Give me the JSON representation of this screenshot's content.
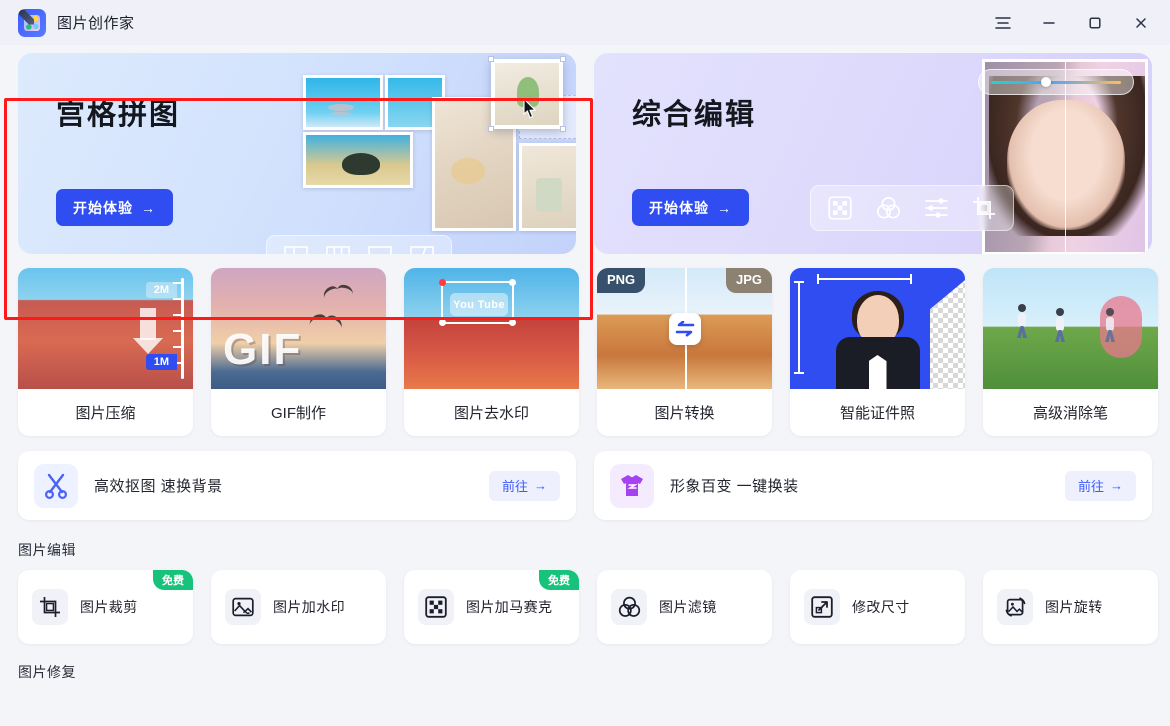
{
  "window": {
    "title": "图片创作家",
    "app_icon": "app-logo-icon",
    "controls": [
      {
        "name": "menu-button",
        "icon": "hamburger-menu-icon"
      },
      {
        "name": "minimize-button",
        "icon": "minimize-icon"
      },
      {
        "name": "maximize-button",
        "icon": "maximize-icon"
      },
      {
        "name": "close-button",
        "icon": "close-icon"
      }
    ]
  },
  "hero": [
    {
      "title": "宫格拼图",
      "cta": "开始体验",
      "cta_arrow": "→",
      "highlighted": true,
      "toolbar_icons": [
        "grid-2-layout-icon",
        "grid-3-columns-icon",
        "grid-rows-layout-icon",
        "grid-diagonal-icon"
      ]
    },
    {
      "title": "综合编辑",
      "cta": "开始体验",
      "cta_arrow": "→",
      "highlighted": false,
      "toolbar_icons": [
        "mosaic-icon",
        "filter-circles-icon",
        "adjust-sliders-icon",
        "crop-icon"
      ]
    }
  ],
  "features": [
    {
      "label": "图片压缩",
      "thumb": "compress-thumb",
      "tags": [
        "2M",
        "1M"
      ]
    },
    {
      "label": "GIF制作",
      "thumb": "gif-thumb",
      "word": "GIF"
    },
    {
      "label": "图片去水印",
      "thumb": "watermark-thumb",
      "word": "You Tube"
    },
    {
      "label": "图片转换",
      "thumb": "convert-thumb",
      "tags": [
        "PNG",
        "JPG"
      ]
    },
    {
      "label": "智能证件照",
      "thumb": "id-photo-thumb"
    },
    {
      "label": "高级消除笔",
      "thumb": "eraser-thumb"
    }
  ],
  "banners": [
    {
      "text": "高效抠图 速换背景",
      "icon": "scissors-icon",
      "action": "前往",
      "arrow": "→"
    },
    {
      "text": "形象百变 一键换装",
      "icon": "tshirt-icon",
      "action": "前往",
      "arrow": "→"
    }
  ],
  "sections": [
    {
      "title": "图片编辑",
      "tiles": [
        {
          "label": "图片裁剪",
          "icon": "crop-icon",
          "badge": "免费"
        },
        {
          "label": "图片加水印",
          "icon": "watermark-image-icon",
          "badge": ""
        },
        {
          "label": "图片加马赛克",
          "icon": "mosaic-icon",
          "badge": "免费"
        },
        {
          "label": "图片滤镜",
          "icon": "filter-circles-icon",
          "badge": ""
        },
        {
          "label": "修改尺寸",
          "icon": "resize-icon",
          "badge": ""
        },
        {
          "label": "图片旋转",
          "icon": "rotate-image-icon",
          "badge": ""
        }
      ]
    }
  ],
  "bottom_section_title": "图片修复",
  "colors": {
    "accent": "#2f4df0",
    "accent_soft": "#eef0fe",
    "badge_green": "#17c37b",
    "annotation_red": "#ff1a1a",
    "page_bg": "#f4f5f9",
    "titlebar_bg": "#f0f1f8"
  }
}
